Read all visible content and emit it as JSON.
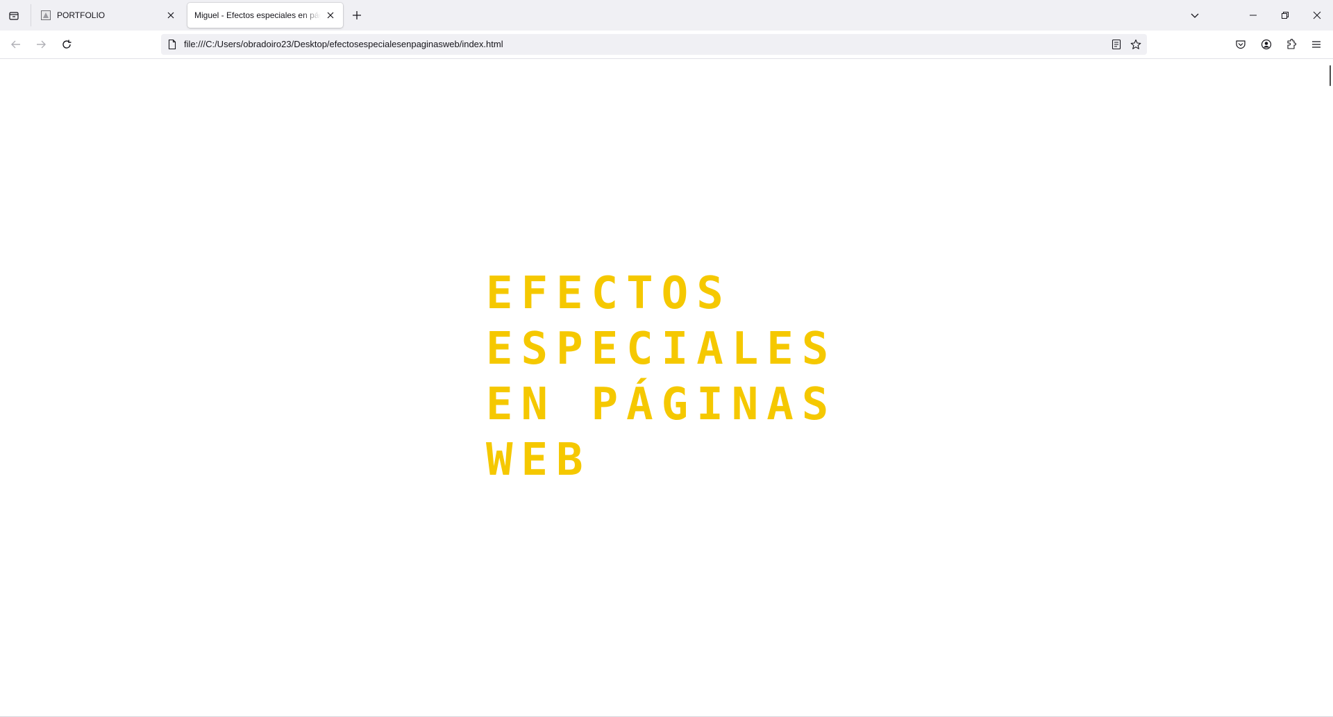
{
  "tabs": [
    {
      "label": "PORTFOLIO",
      "active": false
    },
    {
      "label": "Miguel - Efectos especiales en páginas web",
      "active": true
    }
  ],
  "navbar": {
    "url": "file:///C:/Users/obradoiro23/Desktop/efectosespecialesenpaginasweb/index.html"
  },
  "page": {
    "heading_lines": [
      "EFECTOS",
      "ESPECIALES",
      "EN PÁGINAS",
      "WEB"
    ],
    "heading_color": "#f5c800"
  },
  "icons": {
    "tab_list": "tab-list-icon",
    "new_tab": "plus-icon",
    "list_all_tabs": "chevron-down-icon",
    "minimize": "minimize-icon",
    "restore": "restore-icon",
    "close": "close-icon",
    "back": "back-arrow-icon",
    "forward": "forward-arrow-icon",
    "reload": "reload-icon",
    "page": "page-icon",
    "reader": "reader-view-icon",
    "bookmark": "star-icon",
    "pocket": "pocket-icon",
    "account": "account-icon",
    "extensions": "extensions-icon",
    "menu": "hamburger-menu-icon"
  }
}
